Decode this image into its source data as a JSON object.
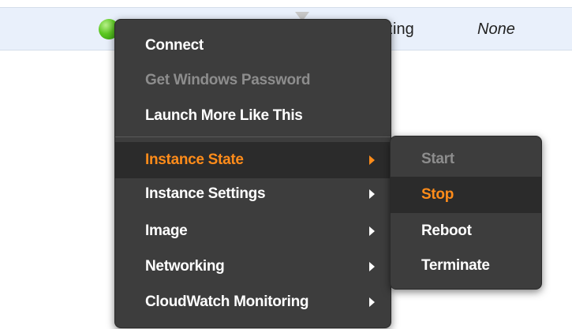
{
  "row": {
    "status_text": "zing",
    "last_column": "None"
  },
  "context_menu": {
    "items": [
      {
        "label": "Connect"
      },
      {
        "label": "Get Windows Password"
      },
      {
        "label": "Launch More Like This"
      },
      {
        "label": "Instance State"
      },
      {
        "label": "Instance Settings"
      },
      {
        "label": "Image"
      },
      {
        "label": "Networking"
      },
      {
        "label": "CloudWatch Monitoring"
      }
    ]
  },
  "submenu": {
    "items": [
      {
        "label": "Start"
      },
      {
        "label": "Stop"
      },
      {
        "label": "Reboot"
      },
      {
        "label": "Terminate"
      }
    ]
  },
  "colors": {
    "highlight": "#ff8c1a",
    "menu_bg": "#3d3d3d",
    "disabled": "#8d8d8d",
    "row_bg": "#e9f0fb"
  },
  "icons": [
    "running-status-icon",
    "filter-icon",
    "chevron-right-icon"
  ]
}
